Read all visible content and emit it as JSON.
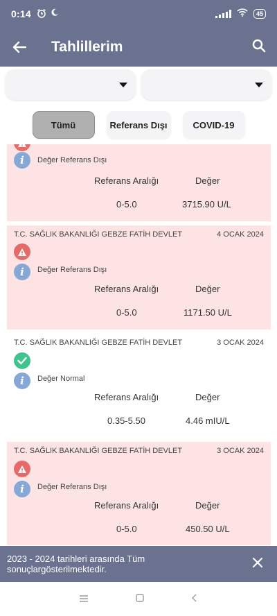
{
  "status_bar": {
    "time": "0:14",
    "battery": "45",
    "left_icons": [
      "alarm-icon",
      "moon-icon"
    ]
  },
  "header": {
    "title": "Tahlillerim"
  },
  "filters": [
    {
      "value": ""
    },
    {
      "value": ""
    }
  ],
  "tabs": [
    {
      "label": "Tümü",
      "active": true
    },
    {
      "label": "Referans Dışı",
      "active": false
    },
    {
      "label": "COVID-19",
      "active": false
    }
  ],
  "results": [
    {
      "hospital": "",
      "date": "",
      "status": "Değer Referans Dışı",
      "ref_header": "Referans Aralığı",
      "value_header": "Değer",
      "ref_range": "0-5.0",
      "value": "3715.90 U/L",
      "abnormal": true
    },
    {
      "hospital": "T.C. SAĞLIK BAKANLIĞI GEBZE FATİH DEVLET",
      "date": "4 OCAK 2024",
      "status": "Değer Referans Dışı",
      "ref_header": "Referans Aralığı",
      "value_header": "Değer",
      "ref_range": "0-5.0",
      "value": "1171.50 U/L",
      "abnormal": true
    },
    {
      "hospital": "T.C. SAĞLIK BAKANLIĞI GEBZE FATİH DEVLET",
      "date": "3 OCAK 2024",
      "status": "Değer Normal",
      "ref_header": "Referans Aralığı",
      "value_header": "Değer",
      "ref_range": "0.35-5.50",
      "value": "4.46 mIU/L",
      "abnormal": false
    },
    {
      "hospital": "T.C. SAĞLIK BAKANLIĞI GEBZE FATİH DEVLET",
      "date": "3 OCAK 2024",
      "status": "Değer Referans Dışı",
      "ref_header": "Referans Aralığı",
      "value_header": "Değer",
      "ref_range": "0-5.0",
      "value": "450.50 U/L",
      "abnormal": true
    }
  ],
  "snackbar": {
    "message": "2023 - 2024 tarihleri arasında Tüm sonuçlargösterilmektedir."
  },
  "colors": {
    "primary": "#6a7290",
    "abnormal_bg": "#fde3e3",
    "warning": "#e76a6a",
    "ok": "#3fc48f",
    "info": "#86a8d6"
  }
}
